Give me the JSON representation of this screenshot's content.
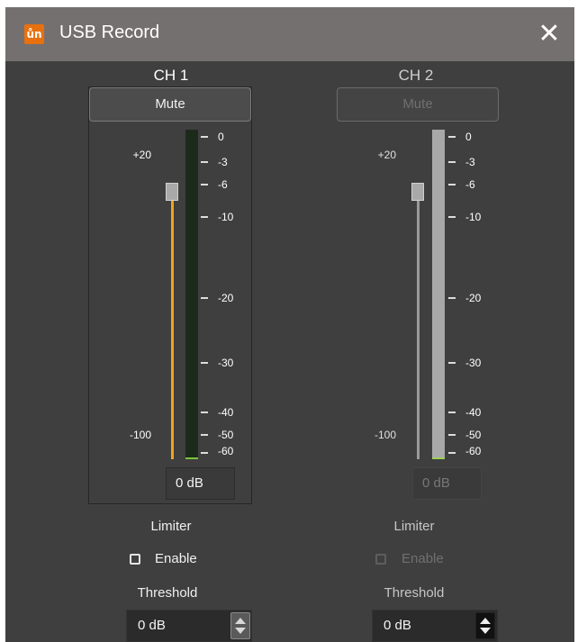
{
  "window": {
    "title": "USB Record",
    "app_icon_glyph": "ůn",
    "close_glyph": "✕",
    "icon_color": "#e8700f"
  },
  "ch1": {
    "title": "CH 1",
    "mute_label": "Mute",
    "fader_top_label": "+20",
    "fader_bottom_label": "-100",
    "meter_ticks": [
      "0",
      "-3",
      "-6",
      "-10",
      "-20",
      "-30",
      "-40",
      "-50",
      "-60"
    ],
    "gain_value": "0 dB",
    "limiter_label": "Limiter",
    "enable_label": "Enable",
    "enable_checked": false,
    "threshold_label": "Threshold",
    "threshold_value": "0 dB",
    "fader_color": "#f2a31b"
  },
  "ch2": {
    "title": "CH 2",
    "mute_label": "Mute",
    "fader_top_label": "+20",
    "fader_bottom_label": "-100",
    "meter_ticks": [
      "0",
      "-3",
      "-6",
      "-10",
      "-20",
      "-30",
      "-40",
      "-50",
      "-60"
    ],
    "gain_value": "0 dB",
    "limiter_label": "Limiter",
    "enable_label": "Enable",
    "enable_checked": false,
    "threshold_label": "Threshold",
    "threshold_value": "0 dB",
    "disabled": true
  }
}
